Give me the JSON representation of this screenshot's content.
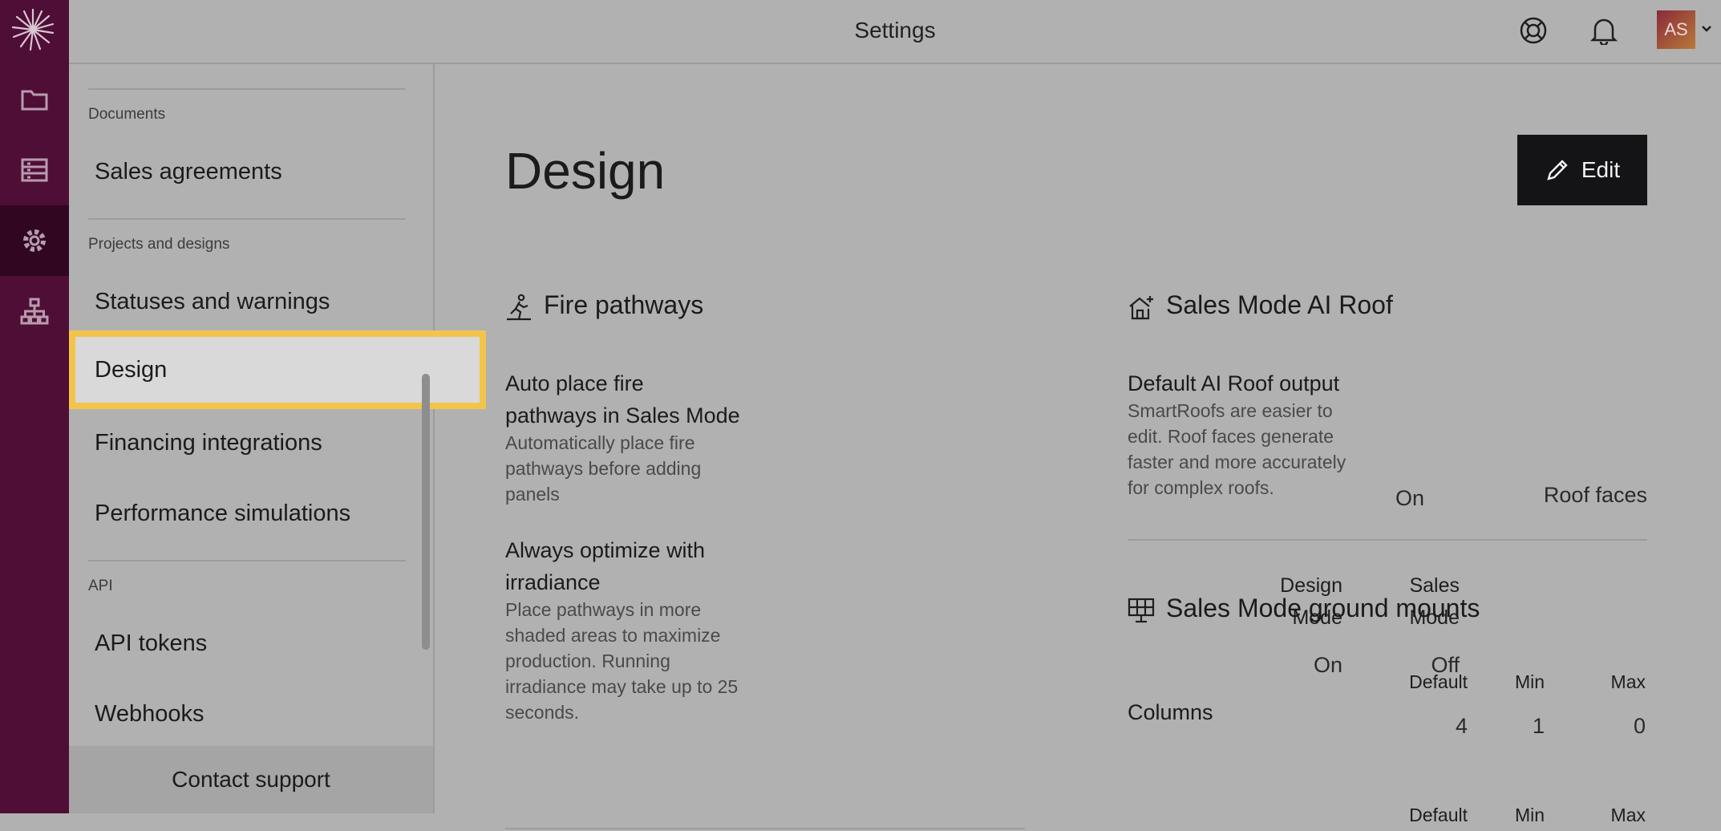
{
  "header": {
    "title": "Settings",
    "avatar_initials": "AS"
  },
  "rail": {
    "items": [
      "projects-folder-icon",
      "database-icon",
      "settings-gear-icon",
      "org-chart-icon"
    ],
    "active": "settings-gear-icon"
  },
  "sidebar": {
    "groups": [
      {
        "label": "Documents",
        "items": [
          "Sales agreements"
        ]
      },
      {
        "label": "Projects and designs",
        "items": [
          "Statuses and warnings",
          "Design",
          "Financing integrations",
          "Performance simulations"
        ]
      },
      {
        "label": "API",
        "items": [
          "API tokens",
          "Webhooks"
        ]
      }
    ],
    "active_item": "Design",
    "footer": "Contact support"
  },
  "page": {
    "title": "Design",
    "edit_label": "Edit"
  },
  "fire_pathways": {
    "title": "Fire pathways",
    "auto_place": {
      "title_line1": "Auto place fire",
      "title_line2": "pathways in Sales Mode",
      "desc_line1": "Automatically place fire",
      "desc_line2": "pathways before adding",
      "desc_line3": "panels",
      "value": "On"
    },
    "always_optimize": {
      "title_line1": "Always optimize with",
      "title_line2": "irradiance",
      "desc_line1": "Place pathways in more",
      "desc_line2": "shaded areas to maximize",
      "desc_line3": "production. Running",
      "desc_line4": "irradiance may take up to 25",
      "desc_line5": "seconds.",
      "col1_line1": "Design",
      "col1_line2": "Mode",
      "col2_line1": "Sales",
      "col2_line2": "Mode",
      "col1_value": "On",
      "col2_value": "Off"
    }
  },
  "ai_roof": {
    "title": "Sales Mode AI Roof",
    "default_output": {
      "title": "Default AI Roof output",
      "desc_line1": "SmartRoofs are easier to",
      "desc_line2": "edit. Roof faces generate",
      "desc_line3": "faster and more accurately",
      "desc_line4": "for complex roofs.",
      "value": "Roof faces"
    }
  },
  "ground_mounts": {
    "title": "Sales Mode ground mounts",
    "headers": [
      "Default",
      "Min",
      "Max"
    ],
    "rows": [
      {
        "label": "Columns",
        "values": [
          "4",
          "1",
          "0"
        ]
      }
    ]
  }
}
